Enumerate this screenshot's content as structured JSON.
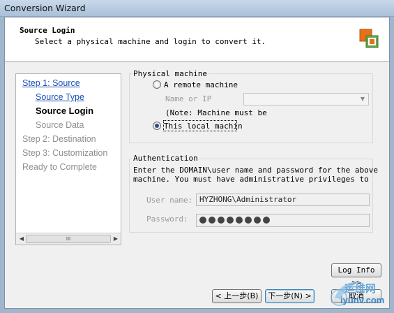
{
  "window": {
    "title": "Conversion Wizard"
  },
  "header": {
    "title": "Source Login",
    "subtitle": "Select a physical machine and login to convert it."
  },
  "nav": {
    "items": [
      {
        "label": "Step 1: Source",
        "state": "link"
      },
      {
        "label": "Source Type",
        "state": "link"
      },
      {
        "label": "Source Login",
        "state": "current"
      },
      {
        "label": "Source Data",
        "state": "dim"
      },
      {
        "label": "Step 2: Destination",
        "state": "dim"
      },
      {
        "label": "Step 3: Customization",
        "state": "dim"
      },
      {
        "label": "Ready to Complete",
        "state": "dim"
      }
    ],
    "scroll_thumb": "III"
  },
  "physical_machine": {
    "group_label": "Physical machine",
    "remote_label": "A remote machine",
    "name_ip_label": "Name or IP",
    "name_ip_value": "",
    "note": "(Note: Machine must be",
    "local_label": "This local machin",
    "selected": "local"
  },
  "authentication": {
    "group_label": "Authentication",
    "description_line1": "Enter the DOMAIN\\user name and password for the above",
    "description_line2": "machine. You must have administrative privileges to",
    "username_label": "User name:",
    "username_value": "HYZHONG\\Administrator",
    "password_label": "Password:",
    "password_mask_count": 8
  },
  "buttons": {
    "log_info": "Log Info >>",
    "back": "< 上一步(B)",
    "next": "下一步(N) >",
    "cancel": "取消"
  },
  "watermark": {
    "line1": "运维网",
    "line2": "iyunv.com"
  },
  "colors": {
    "link": "#1a4fb5",
    "dim_text": "#8e8e8e",
    "logo_orange": "#e8701a",
    "logo_green": "#6aa84f"
  }
}
